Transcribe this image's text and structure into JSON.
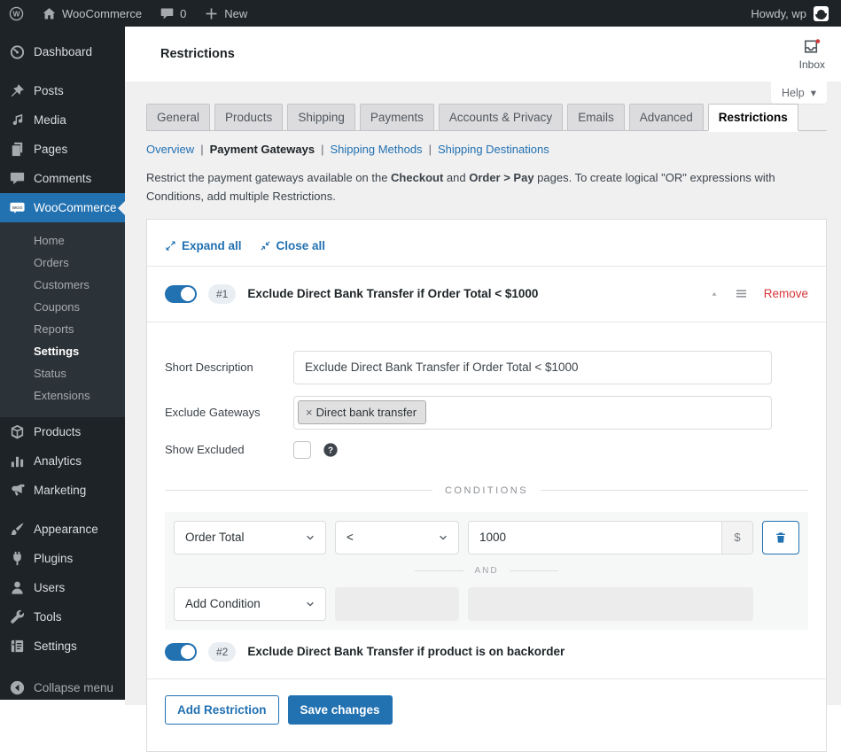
{
  "admin_bar": {
    "site_name": "WooCommerce",
    "comments_count": "0",
    "new_label": "New",
    "howdy": "Howdy, wp"
  },
  "sidebar": {
    "items": [
      {
        "label": "Dashboard"
      },
      {
        "label": "Posts"
      },
      {
        "label": "Media"
      },
      {
        "label": "Pages"
      },
      {
        "label": "Comments"
      },
      {
        "label": "WooCommerce"
      },
      {
        "label": "Products"
      },
      {
        "label": "Analytics"
      },
      {
        "label": "Marketing"
      },
      {
        "label": "Appearance"
      },
      {
        "label": "Plugins"
      },
      {
        "label": "Users"
      },
      {
        "label": "Tools"
      },
      {
        "label": "Settings"
      },
      {
        "label": "Collapse menu"
      }
    ],
    "woocommerce_submenu": [
      {
        "label": "Home"
      },
      {
        "label": "Orders"
      },
      {
        "label": "Customers"
      },
      {
        "label": "Coupons"
      },
      {
        "label": "Reports"
      },
      {
        "label": "Settings",
        "current": true
      },
      {
        "label": "Status"
      },
      {
        "label": "Extensions"
      }
    ]
  },
  "header": {
    "title": "Restrictions",
    "inbox_label": "Inbox",
    "help_label": "Help",
    "help_caret": "▾"
  },
  "tabs": {
    "items": [
      {
        "label": "General"
      },
      {
        "label": "Products"
      },
      {
        "label": "Shipping"
      },
      {
        "label": "Payments"
      },
      {
        "label": "Accounts & Privacy"
      },
      {
        "label": "Emails"
      },
      {
        "label": "Advanced"
      },
      {
        "label": "Restrictions",
        "active": true
      }
    ]
  },
  "subnav": {
    "separator": "|",
    "items": [
      {
        "label": "Overview"
      },
      {
        "label": "Payment Gateways",
        "current": true
      },
      {
        "label": "Shipping Methods"
      },
      {
        "label": "Shipping Destinations"
      }
    ]
  },
  "description": {
    "part1": "Restrict the payment gateways available on the ",
    "bold1": "Checkout",
    "part2": " and ",
    "bold2": "Order > Pay",
    "part3": " pages. To create logical \"OR\" expressions with Conditions, add multiple Restrictions."
  },
  "panel": {
    "expand_all": "Expand all",
    "close_all": "Close all",
    "restriction1": {
      "number": "#1",
      "title": "Exclude Direct Bank Transfer if Order Total < $1000",
      "remove_label": "Remove",
      "enabled": true
    },
    "restriction2": {
      "number": "#2",
      "title": "Exclude Direct Bank Transfer if product is on backorder",
      "enabled": true
    },
    "fields": {
      "short_description": {
        "label": "Short Description",
        "value": "Exclude Direct Bank Transfer if Order Total < $1000"
      },
      "exclude_gateways": {
        "label": "Exclude Gateways",
        "tag": "Direct bank transfer",
        "tag_remove": "×"
      },
      "show_excluded": {
        "label": "Show Excluded",
        "checked": false
      }
    },
    "conditions": {
      "heading": "CONDITIONS",
      "field": "Order Total",
      "operator": "<",
      "value": "1000",
      "currency": "$",
      "and_label": "AND",
      "add_condition": "Add Condition"
    },
    "buttons": {
      "add_restriction": "Add Restriction",
      "save_changes": "Save changes"
    }
  },
  "colors": {
    "accent_blue": "#2271b1",
    "remove_red": "#d63638",
    "admin_dark": "#1d2327",
    "page_bg": "#f0f0f1"
  }
}
